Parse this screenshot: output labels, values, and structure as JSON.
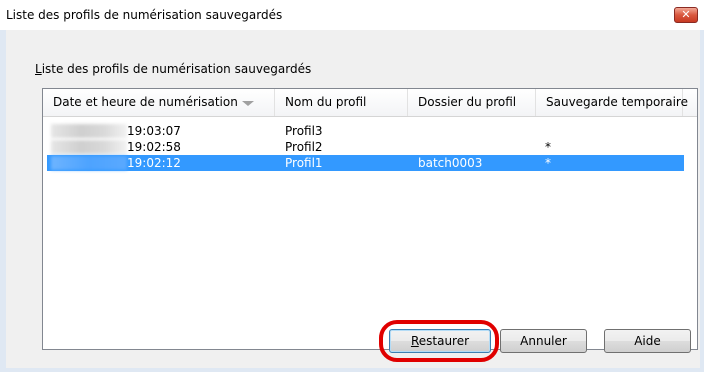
{
  "window": {
    "title": "Liste des profils de numérisation sauvegardés",
    "close_symbol": "✕"
  },
  "group": {
    "label_first_letter": "L",
    "label_rest": "iste des profils de numérisation sauvegardés"
  },
  "table": {
    "columns": [
      "Date et heure de numérisation",
      "Nom du profil",
      "Dossier du profil",
      "Sauvegarde temporaire"
    ],
    "rows": [
      {
        "time": "19:03:07",
        "profile": "Profil3",
        "folder": "",
        "temp": "",
        "selected": false
      },
      {
        "time": "19:02:58",
        "profile": "Profil2",
        "folder": "",
        "temp": "*",
        "selected": false
      },
      {
        "time": "19:02:12",
        "profile": "Profil1",
        "folder": "batch0003",
        "temp": "*",
        "selected": true
      }
    ]
  },
  "buttons": {
    "restore": {
      "first": "R",
      "rest": "estaurer"
    },
    "cancel": "Annuler",
    "help": "Aide"
  },
  "colors": {
    "selection": "#3399ff",
    "highlight_ring": "#e00000"
  }
}
